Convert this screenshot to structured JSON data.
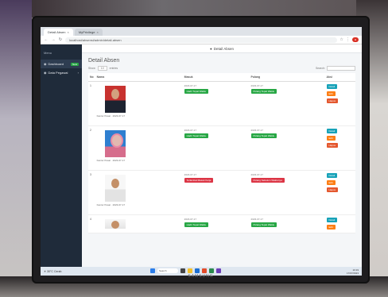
{
  "browser": {
    "tabs": [
      {
        "label": "Detail Absen"
      },
      {
        "label": "MyPrivilege"
      }
    ],
    "url": "localhost/absensi/admin/detail-absen"
  },
  "sidebar": {
    "brand": "Menu",
    "items": [
      {
        "label": "Dashboard",
        "badge": "New"
      },
      {
        "label": "Data Pegawai"
      }
    ]
  },
  "topbar": {
    "title": "Detail Absen"
  },
  "page": {
    "title": "Detail Absen",
    "show_label": "Show",
    "show_value": "10",
    "entries_label": "entries",
    "search_label": "Search:"
  },
  "table": {
    "headers": [
      "No",
      "Nama",
      "Masuk",
      "Pulang",
      "Aksi"
    ],
    "rows": [
      {
        "no": "1",
        "caption": "Kantor Pusat · 2023-07-17",
        "in_date": "2023-07-17",
        "in_status": "Hadir Tepat Waktu",
        "in_ok": true,
        "out_date": "2023-07-17",
        "out_status": "Pulang Tepat Waktu",
        "out_ok": true
      },
      {
        "no": "2",
        "caption": "Kantor Pusat · 2023-07-17",
        "in_date": "2023-07-17",
        "in_status": "Hadir Tepat Waktu",
        "in_ok": true,
        "out_date": "2023-07-17",
        "out_status": "Pulang Tepat Waktu",
        "out_ok": true
      },
      {
        "no": "3",
        "caption": "Kantor Pusat · 2023-07-17",
        "in_date": "2023-07-17",
        "in_status": "Terlambat Masuk Kerja",
        "in_ok": false,
        "out_date": "2023-07-17",
        "out_status": "Pulang Sebelum Waktunya",
        "out_ok": false
      },
      {
        "no": "4",
        "caption": "",
        "in_date": "2023-07-17",
        "in_status": "Hadir Tepat Waktu",
        "in_ok": true,
        "out_date": "2023-07-17",
        "out_status": "Pulang Tepat Waktu",
        "out_ok": true
      }
    ],
    "actions": {
      "detail": "Detail",
      "edit": "Edit",
      "delete": "Hapus"
    }
  },
  "taskbar": {
    "weather_temp": "30°C",
    "weather_desc": "Cerah",
    "search_placeholder": "Search",
    "time": "10:19",
    "date": "17/07/2023"
  },
  "monitor": {
    "brand": "SAMSUNG"
  }
}
